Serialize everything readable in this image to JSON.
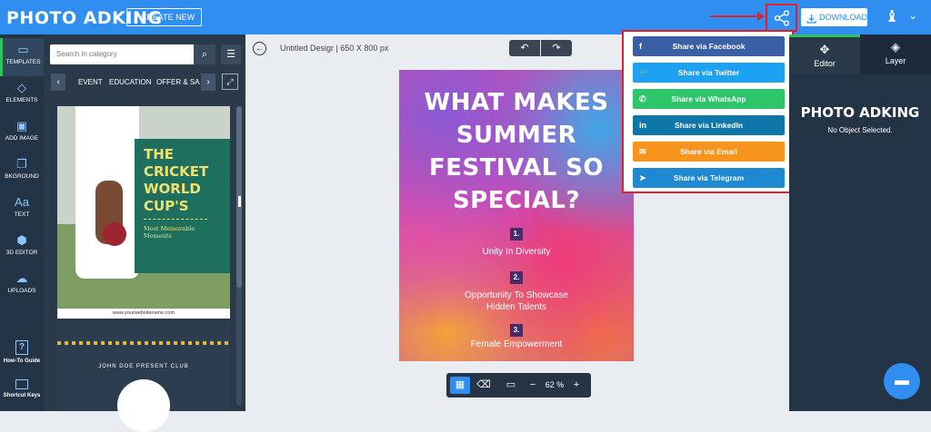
{
  "header": {
    "logo": "PHOTO ADKING",
    "create_label": "+ CREATE NEW",
    "download_label": "DOWNLOAD"
  },
  "left_rail": {
    "items": [
      {
        "label": "TEMPLATES",
        "icon": "templates-icon"
      },
      {
        "label": "ELEMENTS",
        "icon": "elements-icon"
      },
      {
        "label": "ADD IMAGE",
        "icon": "image-icon"
      },
      {
        "label": "BKGROUND",
        "icon": "background-icon"
      },
      {
        "label": "TEXT",
        "icon": "text-icon"
      },
      {
        "label": "3D EDITOR",
        "icon": "3d-icon"
      },
      {
        "label": "UPLOADS",
        "icon": "upload-icon"
      }
    ],
    "bottom": [
      {
        "label": "How-To Guide"
      },
      {
        "label": "Shortcut Keys"
      }
    ]
  },
  "panel": {
    "search_placeholder": "Search in category",
    "categories": [
      "EVENT",
      "EDUCATION",
      "OFFER & SA"
    ],
    "template1": {
      "title": "THE CRICKET WORLD CUP'S",
      "subtitle": "Most Memorable Moments",
      "url": "www.yourwebsitename.com"
    },
    "template2": {
      "text": "JOHN DOE PRESENT CLUB"
    }
  },
  "canvas": {
    "doc_name": "Untitled Desigr | 650 X 800 px",
    "zoom": "62 %"
  },
  "poster": {
    "title": "WHAT MAKES SUMMER FESTIVAL SO SPECIAL?",
    "items": [
      {
        "num": "1.",
        "text": "Unity In Diversity"
      },
      {
        "num": "2.",
        "text": "Opportunity To Showcase Hidden Talents"
      },
      {
        "num": "3.",
        "text": "Female Empowerment"
      }
    ]
  },
  "share_menu": {
    "items": [
      {
        "label": "Share via Facebook",
        "color": "#3b5fa5",
        "icon": "facebook-icon"
      },
      {
        "label": "Share via Twitter",
        "color": "#1da1f2",
        "icon": "twitter-icon"
      },
      {
        "label": "Share via WhatsApp",
        "color": "#2dc46a",
        "icon": "whatsapp-icon"
      },
      {
        "label": "Share via LinkedIn",
        "color": "#0e76a8",
        "icon": "linkedin-icon"
      },
      {
        "label": "Share via Email",
        "color": "#f7941d",
        "icon": "email-icon"
      },
      {
        "label": "Share via Telegram",
        "color": "#1e88d1",
        "icon": "telegram-icon"
      }
    ]
  },
  "right_panel": {
    "tabs": [
      "Editor",
      "Layer"
    ],
    "logo": "PHOTO ADKING",
    "empty_text": "No Object Selected."
  }
}
